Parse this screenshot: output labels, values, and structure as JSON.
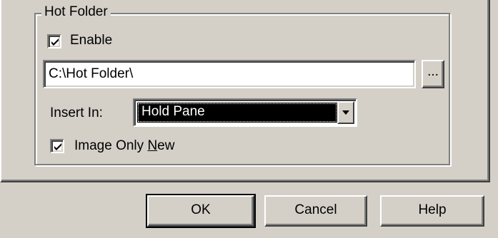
{
  "group": {
    "title": "Hot Folder"
  },
  "enable": {
    "label": "Enable",
    "checked": true
  },
  "path": {
    "value": "C:\\Hot Folder\\"
  },
  "browse": {
    "label": "..."
  },
  "insert_in": {
    "label": "Insert In:",
    "selected": "Hold Pane"
  },
  "image_only_new": {
    "label_prefix": "Image Only ",
    "label_accel": "N",
    "label_suffix": "ew",
    "checked": true
  },
  "buttons": {
    "ok": "OK",
    "cancel": "Cancel",
    "help": "Help"
  }
}
